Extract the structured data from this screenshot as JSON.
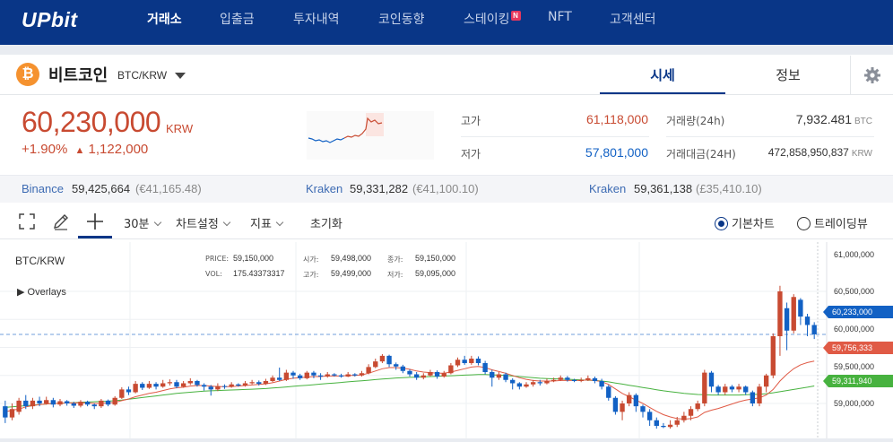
{
  "nav": {
    "logo": "UPbit",
    "items": [
      "거래소",
      "입출금",
      "투자내역",
      "코인동향",
      "스테이킹",
      "NFT",
      "고객센터"
    ],
    "new_badge": "N"
  },
  "coin": {
    "icon": "bitcoin-icon",
    "icon_glyph": "₿",
    "name": "비트코인",
    "market": "BTC/KRW"
  },
  "tabs": [
    "시세",
    "정보"
  ],
  "ticker": {
    "price": "60,230,000",
    "unit": "KRW",
    "change_pct": "+1.90%",
    "change_arrow": "▲",
    "change_amt": "1,122,000"
  },
  "stats": {
    "high_label": "고가",
    "high": "61,118,000",
    "low_label": "저가",
    "low": "57,801,000",
    "vol_label": "거래량(24h)",
    "vol": "7,932.481",
    "vol_unit": "BTC",
    "amt_label": "거래대금(24H)",
    "amt": "472,858,950,837",
    "amt_unit": "KRW"
  },
  "exchanges": [
    {
      "name": "Binance",
      "price": "59,425,664",
      "sub": "(€41,165.48)"
    },
    {
      "name": "Kraken",
      "price": "59,331,282",
      "sub": "(€41,100.10)"
    },
    {
      "name": "Kraken",
      "price": "59,361,138",
      "sub": "(£35,410.10)"
    }
  ],
  "toolbar": {
    "interval": "30분",
    "chart_settings": "차트설정",
    "indicators": "지표",
    "reset": "초기화",
    "radio_basic": "기본차트",
    "radio_tv": "트레이딩뷰"
  },
  "chart_header": {
    "pair": "BTC/KRW",
    "overlays": "▶ Overlays",
    "price_label": "PRICE:",
    "price": "59,150,000",
    "vol_label": "VOL:",
    "vol": "175.43373317",
    "open_label": "시가:",
    "open": "59,498,000",
    "high_label": "고가:",
    "high": "59,499,000",
    "close_label": "종가:",
    "close": "59,150,000",
    "low_label": "저가:",
    "low": "59,095,000"
  },
  "colors": {
    "brand": "#093687",
    "up": "#c84a31",
    "down": "#1261c4",
    "ma_short": "#e05a45",
    "ma_long": "#47b23f"
  },
  "chart_data": {
    "type": "candlestick",
    "y_ticks": [
      "61,000,000",
      "60,500,000",
      "60,000,000",
      "59,500,000",
      "59,000,000"
    ],
    "ylim": [
      58600000,
      61200000
    ],
    "current_price_tag": "60,233,000",
    "ma_short_tag": "59,756,333",
    "ma_long_tag": "59,311,940",
    "candles": [
      [
        58950000,
        58750000,
        59050000,
        58650000
      ],
      [
        58750000,
        58900000,
        59000000,
        58700000
      ],
      [
        58850000,
        59050000,
        59100000,
        58800000
      ],
      [
        59050000,
        58950000,
        59150000,
        58900000
      ],
      [
        58950000,
        59050000,
        59100000,
        58900000
      ],
      [
        59050000,
        59000000,
        59120000,
        58950000
      ],
      [
        59000000,
        59060000,
        59120000,
        58980000
      ],
      [
        59060000,
        58980000,
        59100000,
        58930000
      ],
      [
        58980000,
        59040000,
        59080000,
        58950000
      ],
      [
        59040000,
        59000000,
        59060000,
        58960000
      ],
      [
        59000000,
        58960000,
        59030000,
        58920000
      ],
      [
        58960000,
        59030000,
        59060000,
        58930000
      ],
      [
        59030000,
        58980000,
        59050000,
        58950000
      ],
      [
        58980000,
        58950000,
        59000000,
        58900000
      ],
      [
        58950000,
        59050000,
        59080000,
        58920000
      ],
      [
        59050000,
        58980000,
        59070000,
        58950000
      ],
      [
        58980000,
        59100000,
        59130000,
        58960000
      ],
      [
        59100000,
        59250000,
        59290000,
        59080000
      ],
      [
        59250000,
        59200000,
        59300000,
        59150000
      ],
      [
        59200000,
        59350000,
        59400000,
        59180000
      ],
      [
        59350000,
        59280000,
        59380000,
        59240000
      ],
      [
        59280000,
        59350000,
        59400000,
        59260000
      ],
      [
        59350000,
        59300000,
        59380000,
        59250000
      ],
      [
        59300000,
        59360000,
        59420000,
        59280000
      ],
      [
        59360000,
        59380000,
        59430000,
        59320000
      ],
      [
        59380000,
        59300000,
        59420000,
        59270000
      ],
      [
        59300000,
        59360000,
        59400000,
        59280000
      ],
      [
        59360000,
        59400000,
        59450000,
        59330000
      ],
      [
        59400000,
        59330000,
        59420000,
        59300000
      ],
      [
        59330000,
        59300000,
        59360000,
        59230000
      ],
      [
        59300000,
        59250000,
        59330000,
        59140000
      ],
      [
        59250000,
        59310000,
        59360000,
        59220000
      ],
      [
        59310000,
        59300000,
        59340000,
        59260000
      ],
      [
        59300000,
        59340000,
        59380000,
        59280000
      ],
      [
        59340000,
        59320000,
        59360000,
        59300000
      ],
      [
        59320000,
        59360000,
        59400000,
        59300000
      ],
      [
        59360000,
        59380000,
        59420000,
        59340000
      ],
      [
        59380000,
        59350000,
        59410000,
        59320000
      ],
      [
        59350000,
        59400000,
        59440000,
        59330000
      ],
      [
        59400000,
        59460000,
        59500000,
        59380000
      ],
      [
        59460000,
        59420000,
        59640000,
        59400000
      ],
      [
        59420000,
        59550000,
        59600000,
        59400000
      ],
      [
        59550000,
        59500000,
        59580000,
        59440000
      ],
      [
        59500000,
        59450000,
        59530000,
        59420000
      ],
      [
        59450000,
        59550000,
        59580000,
        59430000
      ],
      [
        59550000,
        59500000,
        59580000,
        59450000
      ],
      [
        59500000,
        59480000,
        59540000,
        59420000
      ],
      [
        59480000,
        59520000,
        59560000,
        59460000
      ],
      [
        59520000,
        59500000,
        59540000,
        59480000
      ],
      [
        59500000,
        59480000,
        59530000,
        59460000
      ],
      [
        59480000,
        59520000,
        59560000,
        59470000
      ],
      [
        59520000,
        59500000,
        59540000,
        59480000
      ],
      [
        59500000,
        59540000,
        59580000,
        59480000
      ],
      [
        59540000,
        59650000,
        59700000,
        59520000
      ],
      [
        59650000,
        59750000,
        59800000,
        59630000
      ],
      [
        59750000,
        59850000,
        59880000,
        59720000
      ],
      [
        59850000,
        59700000,
        59870000,
        59650000
      ],
      [
        59700000,
        59660000,
        59730000,
        59600000
      ],
      [
        59660000,
        59580000,
        59690000,
        59540000
      ],
      [
        59580000,
        59520000,
        59610000,
        59480000
      ],
      [
        59520000,
        59460000,
        59560000,
        59420000
      ],
      [
        59460000,
        59500000,
        59540000,
        59430000
      ],
      [
        59500000,
        59560000,
        59600000,
        59480000
      ],
      [
        59560000,
        59480000,
        59590000,
        59440000
      ],
      [
        59480000,
        59540000,
        59580000,
        59460000
      ],
      [
        59540000,
        59680000,
        59720000,
        59520000
      ],
      [
        59680000,
        59780000,
        59820000,
        59650000
      ],
      [
        59780000,
        59720000,
        59850000,
        59690000
      ],
      [
        59720000,
        59800000,
        59850000,
        59690000
      ],
      [
        59800000,
        59720000,
        59840000,
        59680000
      ],
      [
        59720000,
        59560000,
        59760000,
        59520000
      ],
      [
        59560000,
        59460000,
        59600000,
        59300000
      ],
      [
        59460000,
        59520000,
        59560000,
        59420000
      ],
      [
        59520000,
        59420000,
        59550000,
        59380000
      ],
      [
        59420000,
        59360000,
        59450000,
        59250000
      ],
      [
        59360000,
        59300000,
        59380000,
        59250000
      ],
      [
        59300000,
        59340000,
        59380000,
        59280000
      ],
      [
        59340000,
        59380000,
        59420000,
        59300000
      ],
      [
        59380000,
        59360000,
        59420000,
        59320000
      ],
      [
        59360000,
        59400000,
        59440000,
        59340000
      ],
      [
        59400000,
        59420000,
        59460000,
        59380000
      ],
      [
        59420000,
        59460000,
        59500000,
        59400000
      ],
      [
        59460000,
        59420000,
        59490000,
        59390000
      ],
      [
        59420000,
        59400000,
        59440000,
        59380000
      ],
      [
        59400000,
        59420000,
        59460000,
        59380000
      ],
      [
        59420000,
        59450000,
        59500000,
        59400000
      ],
      [
        59450000,
        59400000,
        59480000,
        59360000
      ],
      [
        59400000,
        59300000,
        59440000,
        59250000
      ],
      [
        59300000,
        59100000,
        59330000,
        59050000
      ],
      [
        59100000,
        58850000,
        59130000,
        58800000
      ],
      [
        58850000,
        59000000,
        59050000,
        58700000
      ],
      [
        59000000,
        59150000,
        59200000,
        58950000
      ],
      [
        59150000,
        58950000,
        59180000,
        58850000
      ],
      [
        58950000,
        58850000,
        58980000,
        58750000
      ],
      [
        58850000,
        58700000,
        58900000,
        58600000
      ],
      [
        58700000,
        58600000,
        58750000,
        58550000
      ],
      [
        58600000,
        58580000,
        58650000,
        58560000
      ],
      [
        58580000,
        58620000,
        58700000,
        58550000
      ],
      [
        58620000,
        58700000,
        58760000,
        58580000
      ],
      [
        58700000,
        58780000,
        58850000,
        58660000
      ],
      [
        58780000,
        58900000,
        58950000,
        58700000
      ],
      [
        58900000,
        59000000,
        59050000,
        58860000
      ],
      [
        59000000,
        59550000,
        59600000,
        58950000
      ],
      [
        59550000,
        59300000,
        59580000,
        59200000
      ],
      [
        59300000,
        59200000,
        59330000,
        59150000
      ],
      [
        59200000,
        59300000,
        59350000,
        59150000
      ],
      [
        59300000,
        59250000,
        59330000,
        59200000
      ],
      [
        59250000,
        59300000,
        59350000,
        59200000
      ],
      [
        59300000,
        59200000,
        59320000,
        59150000
      ],
      [
        59200000,
        59000000,
        59230000,
        58950000
      ],
      [
        59000000,
        59300000,
        59350000,
        58950000
      ],
      [
        59300000,
        59500000,
        59530000,
        59200000
      ],
      [
        59500000,
        60200000,
        60250000,
        59450000
      ],
      [
        60200000,
        61000000,
        61100000,
        59850000
      ],
      [
        60700000,
        60300000,
        60800000,
        59950000
      ],
      [
        60300000,
        60900000,
        60950000,
        60250000
      ],
      [
        60850000,
        60550000,
        60880000,
        60400000
      ],
      [
        60550000,
        60400000,
        60600000,
        60200000
      ],
      [
        60400000,
        60233000,
        60450000,
        60150000
      ]
    ],
    "ma_short": [
      58850000,
      58880000,
      58900000,
      58940000,
      58960000,
      58980000,
      58990000,
      59000000,
      59000000,
      59010000,
      59010000,
      59010000,
      59010000,
      59000000,
      59000000,
      59010000,
      59020000,
      59050000,
      59080000,
      59120000,
      59150000,
      59180000,
      59200000,
      59230000,
      59260000,
      59280000,
      59290000,
      59310000,
      59320000,
      59320000,
      59310000,
      59300000,
      59300000,
      59300000,
      59310000,
      59320000,
      59330000,
      59340000,
      59350000,
      59370000,
      59400000,
      59430000,
      59450000,
      59460000,
      59470000,
      59480000,
      59480000,
      59490000,
      59490000,
      59490000,
      59500000,
      59500000,
      59510000,
      59540000,
      59580000,
      59620000,
      59640000,
      59640000,
      59630000,
      59610000,
      59580000,
      59560000,
      59550000,
      59540000,
      59540000,
      59560000,
      59590000,
      59620000,
      59650000,
      59660000,
      59640000,
      59600000,
      59570000,
      59540000,
      59500000,
      59460000,
      59430000,
      59410000,
      59400000,
      59400000,
      59400000,
      59410000,
      59410000,
      59410000,
      59410000,
      59420000,
      59410000,
      59390000,
      59340000,
      59260000,
      59180000,
      59120000,
      59060000,
      59000000,
      58930000,
      58860000,
      58800000,
      58760000,
      58730000,
      58720000,
      58730000,
      58760000,
      58840000,
      58880000,
      58910000,
      58950000,
      58990000,
      59030000,
      59060000,
      59080000,
      59100000,
      59150000,
      59250000,
      59400000,
      59520000,
      59620000,
      59690000,
      59730000,
      59756333
    ],
    "ma_long": [
      58930000,
      58940000,
      58950000,
      58960000,
      58970000,
      58980000,
      58990000,
      59000000,
      59005000,
      59010000,
      59015000,
      59020000,
      59025000,
      59030000,
      59035000,
      59040000,
      59050000,
      59060000,
      59075000,
      59090000,
      59105000,
      59120000,
      59135000,
      59150000,
      59165000,
      59180000,
      59190000,
      59200000,
      59210000,
      59220000,
      59225000,
      59230000,
      59235000,
      59240000,
      59245000,
      59250000,
      59255000,
      59260000,
      59265000,
      59275000,
      59285000,
      59295000,
      59305000,
      59315000,
      59325000,
      59335000,
      59345000,
      59355000,
      59365000,
      59375000,
      59385000,
      59395000,
      59405000,
      59415000,
      59425000,
      59435000,
      59445000,
      59455000,
      59460000,
      59465000,
      59470000,
      59475000,
      59480000,
      59485000,
      59490000,
      59495000,
      59500000,
      59505000,
      59510000,
      59515000,
      59515000,
      59510000,
      59505000,
      59500000,
      59490000,
      59480000,
      59470000,
      59460000,
      59450000,
      59445000,
      59440000,
      59435000,
      59430000,
      59425000,
      59420000,
      59415000,
      59410000,
      59400000,
      59385000,
      59365000,
      59345000,
      59325000,
      59305000,
      59285000,
      59265000,
      59245000,
      59225000,
      59210000,
      59195000,
      59180000,
      59170000,
      59160000,
      59155000,
      59150000,
      59150000,
      59150000,
      59150000,
      59150000,
      59155000,
      59160000,
      59165000,
      59175000,
      59190000,
      59210000,
      59230000,
      59250000,
      59270000,
      59290000,
      59311940
    ]
  }
}
